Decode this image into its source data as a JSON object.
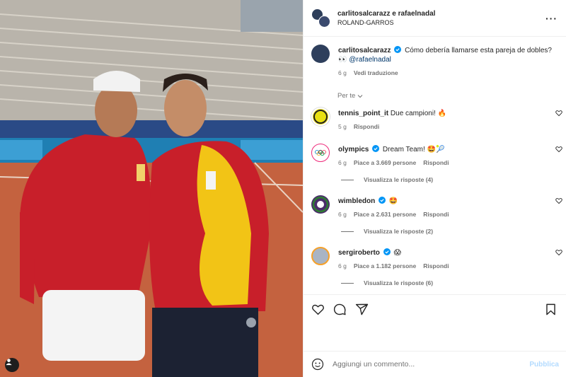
{
  "post": {
    "authors": "carlitosalcarazz e rafaelnadal",
    "location": "ROLAND-GARROS"
  },
  "caption": {
    "user": "carlitosalcarazz",
    "text": "Cómo debería llamarse esta pareja de dobles? 👀",
    "mention": "@rafaelnadal",
    "time": "6 g",
    "translate_label": "Vedi traduzione"
  },
  "sort_label": "Per te",
  "comments": [
    {
      "user": "tennis_point_it",
      "verified": false,
      "text": "Due campioni! 🔥",
      "time": "5 g",
      "likes": "",
      "reply_label": "Rispondi",
      "view_replies": ""
    },
    {
      "user": "olympics",
      "verified": true,
      "text": "Dream Team! 🤩🎾",
      "time": "6 g",
      "likes": "Piace a 3.669 persone",
      "reply_label": "Rispondi",
      "view_replies": "Visualizza le risposte (4)"
    },
    {
      "user": "wimbledon",
      "verified": true,
      "text": "🤩",
      "time": "6 g",
      "likes": "Piace a 2.631 persone",
      "reply_label": "Rispondi",
      "view_replies": "Visualizza le risposte (2)"
    },
    {
      "user": "sergiroberto",
      "verified": true,
      "text": "😱",
      "time": "6 g",
      "likes": "Piace a 1.182 persone",
      "reply_label": "Rispondi",
      "view_replies": "Visualizza le risposte (6)"
    }
  ],
  "add_comment": {
    "placeholder": "Aggiungi un commento...",
    "publish_label": "Pubblica"
  },
  "colors": {
    "verified": "#0095f6",
    "link": "#00376b",
    "muted": "#737373",
    "publish_disabled": "#b3dbff"
  },
  "icons": [
    "more-icon",
    "verified-icon",
    "heart-icon",
    "comment-icon",
    "share-icon",
    "bookmark-icon",
    "emoji-icon",
    "chevron-down-icon",
    "user-tag-icon"
  ]
}
